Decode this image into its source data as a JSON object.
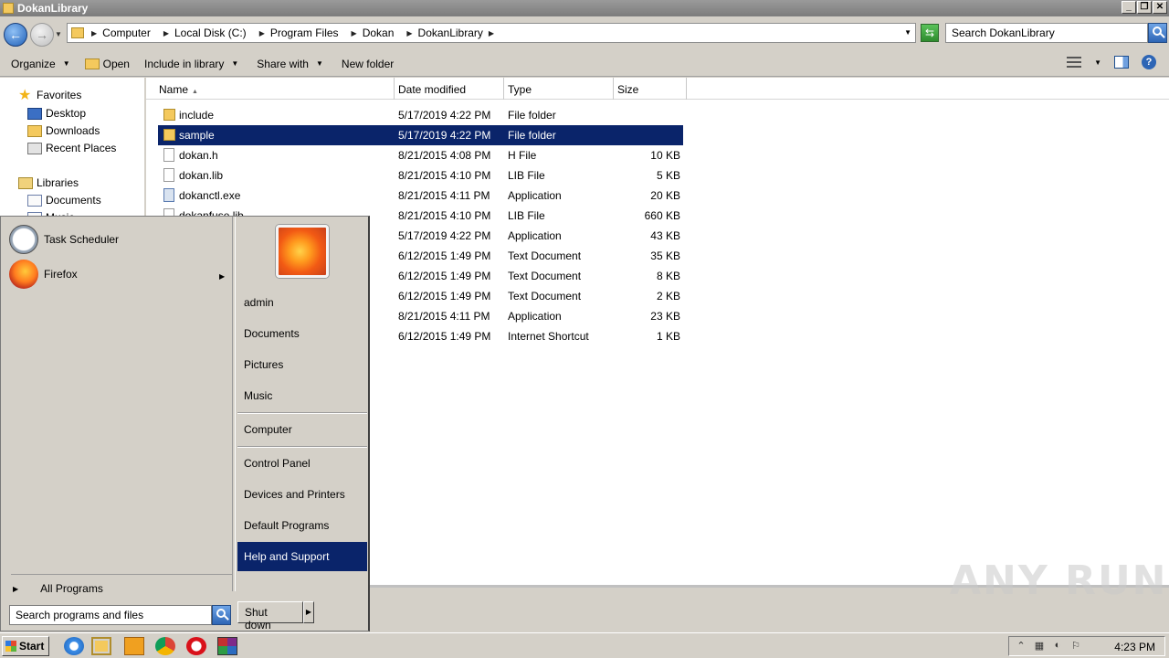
{
  "window": {
    "title": "DokanLibrary",
    "controls": [
      "_",
      "❐",
      "✕"
    ]
  },
  "address": {
    "crumbs": [
      "Computer",
      "Local Disk (C:)",
      "Program Files",
      "Dokan",
      "DokanLibrary"
    ]
  },
  "search": {
    "placeholder": "Search DokanLibrary"
  },
  "toolbar": {
    "organize": "Organize",
    "open": "Open",
    "include": "Include in library",
    "share": "Share with",
    "newfolder": "New folder"
  },
  "navpane": {
    "favorites": "Favorites",
    "desktop": "Desktop",
    "downloads": "Downloads",
    "recent": "Recent Places",
    "libraries": "Libraries",
    "documents": "Documents",
    "music_partial": "Music"
  },
  "columns": {
    "name": "Name",
    "date": "Date modified",
    "type": "Type",
    "size": "Size"
  },
  "files": [
    {
      "name": "include",
      "date": "5/17/2019 4:22 PM",
      "type": "File folder",
      "size": "",
      "icon": "folder"
    },
    {
      "name": "sample",
      "date": "5/17/2019 4:22 PM",
      "type": "File folder",
      "size": "",
      "icon": "folder"
    },
    {
      "name": "dokan.h",
      "date": "8/21/2015 4:08 PM",
      "type": "H File",
      "size": "10 KB",
      "icon": "file"
    },
    {
      "name": "dokan.lib",
      "date": "8/21/2015 4:10 PM",
      "type": "LIB File",
      "size": "5 KB",
      "icon": "file"
    },
    {
      "name": "dokanctl.exe",
      "date": "8/21/2015 4:11 PM",
      "type": "Application",
      "size": "20 KB",
      "icon": "exe"
    },
    {
      "name": "dokanfuse.lib",
      "date": "8/21/2015 4:10 PM",
      "type": "LIB File",
      "size": "660 KB",
      "icon": "file"
    },
    {
      "name": "",
      "date": "5/17/2019 4:22 PM",
      "type": "Application",
      "size": "43 KB",
      "icon": "exe"
    },
    {
      "name": "",
      "date": "6/12/2015 1:49 PM",
      "type": "Text Document",
      "size": "35 KB",
      "icon": "file"
    },
    {
      "name": "",
      "date": "6/12/2015 1:49 PM",
      "type": "Text Document",
      "size": "8 KB",
      "icon": "file"
    },
    {
      "name": "",
      "date": "6/12/2015 1:49 PM",
      "type": "Text Document",
      "size": "2 KB",
      "icon": "file"
    },
    {
      "name": "",
      "date": "8/21/2015 4:11 PM",
      "type": "Application",
      "size": "23 KB",
      "icon": "exe"
    },
    {
      "name": "",
      "date": "6/12/2015 1:49 PM",
      "type": "Internet Shortcut",
      "size": "1 KB",
      "icon": "file"
    }
  ],
  "startmenu": {
    "programs": [
      {
        "label": "Task Scheduler",
        "icon": "clock-icon"
      },
      {
        "label": "Firefox",
        "icon": "firefox-icon"
      }
    ],
    "all_programs": "All Programs",
    "search_placeholder": "Search programs and files",
    "right_links": [
      "admin",
      "Documents",
      "Pictures",
      "Music",
      "Computer",
      "Control Panel",
      "Devices and Printers",
      "Default Programs",
      "Help and Support"
    ],
    "highlighted": "Help and Support",
    "shutdown": "Shut down"
  },
  "taskbar": {
    "start": "Start",
    "clock": "4:23 PM"
  },
  "watermark": "ANY RUN",
  "colors": {
    "selection": "#0a246a",
    "chrome": "#d4d0c8"
  }
}
